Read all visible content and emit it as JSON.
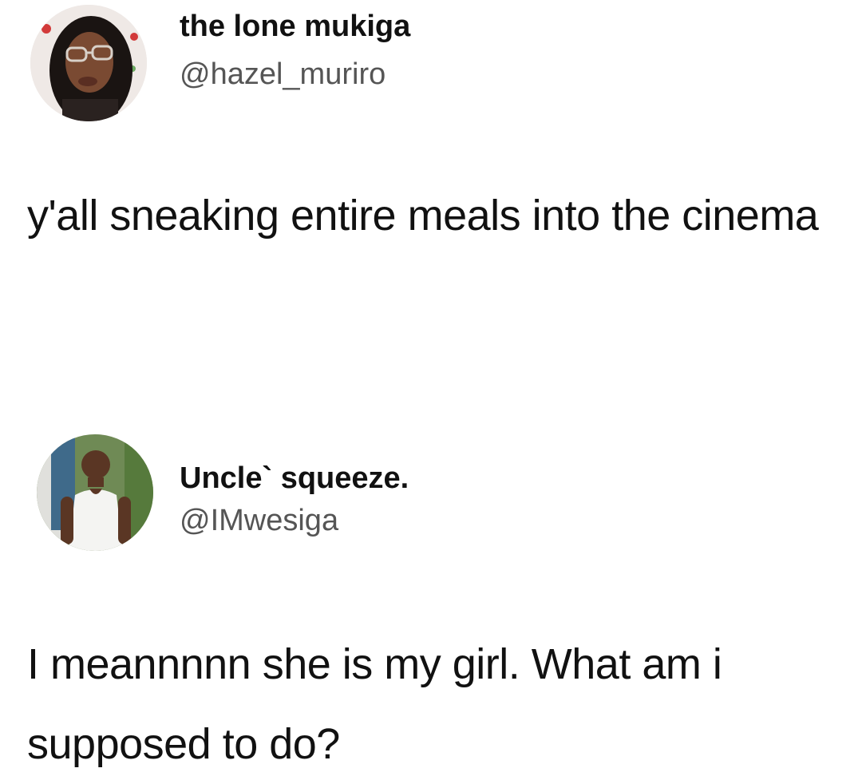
{
  "tweets": [
    {
      "display_name": "the lone mukiga",
      "handle": "@hazel_muriro",
      "text": "y'all sneaking entire meals into the cinema",
      "avatar_icon": "profile-photo-woman-glasses"
    },
    {
      "display_name": "Uncle` squeeze.",
      "handle": "@IMwesiga",
      "text": "I meannnnn she is my girl. What am i supposed to do?",
      "avatar_icon": "profile-photo-man-tank-top"
    }
  ],
  "colors": {
    "background": "#ffffff",
    "text": "#111111",
    "handle": "#555555"
  }
}
